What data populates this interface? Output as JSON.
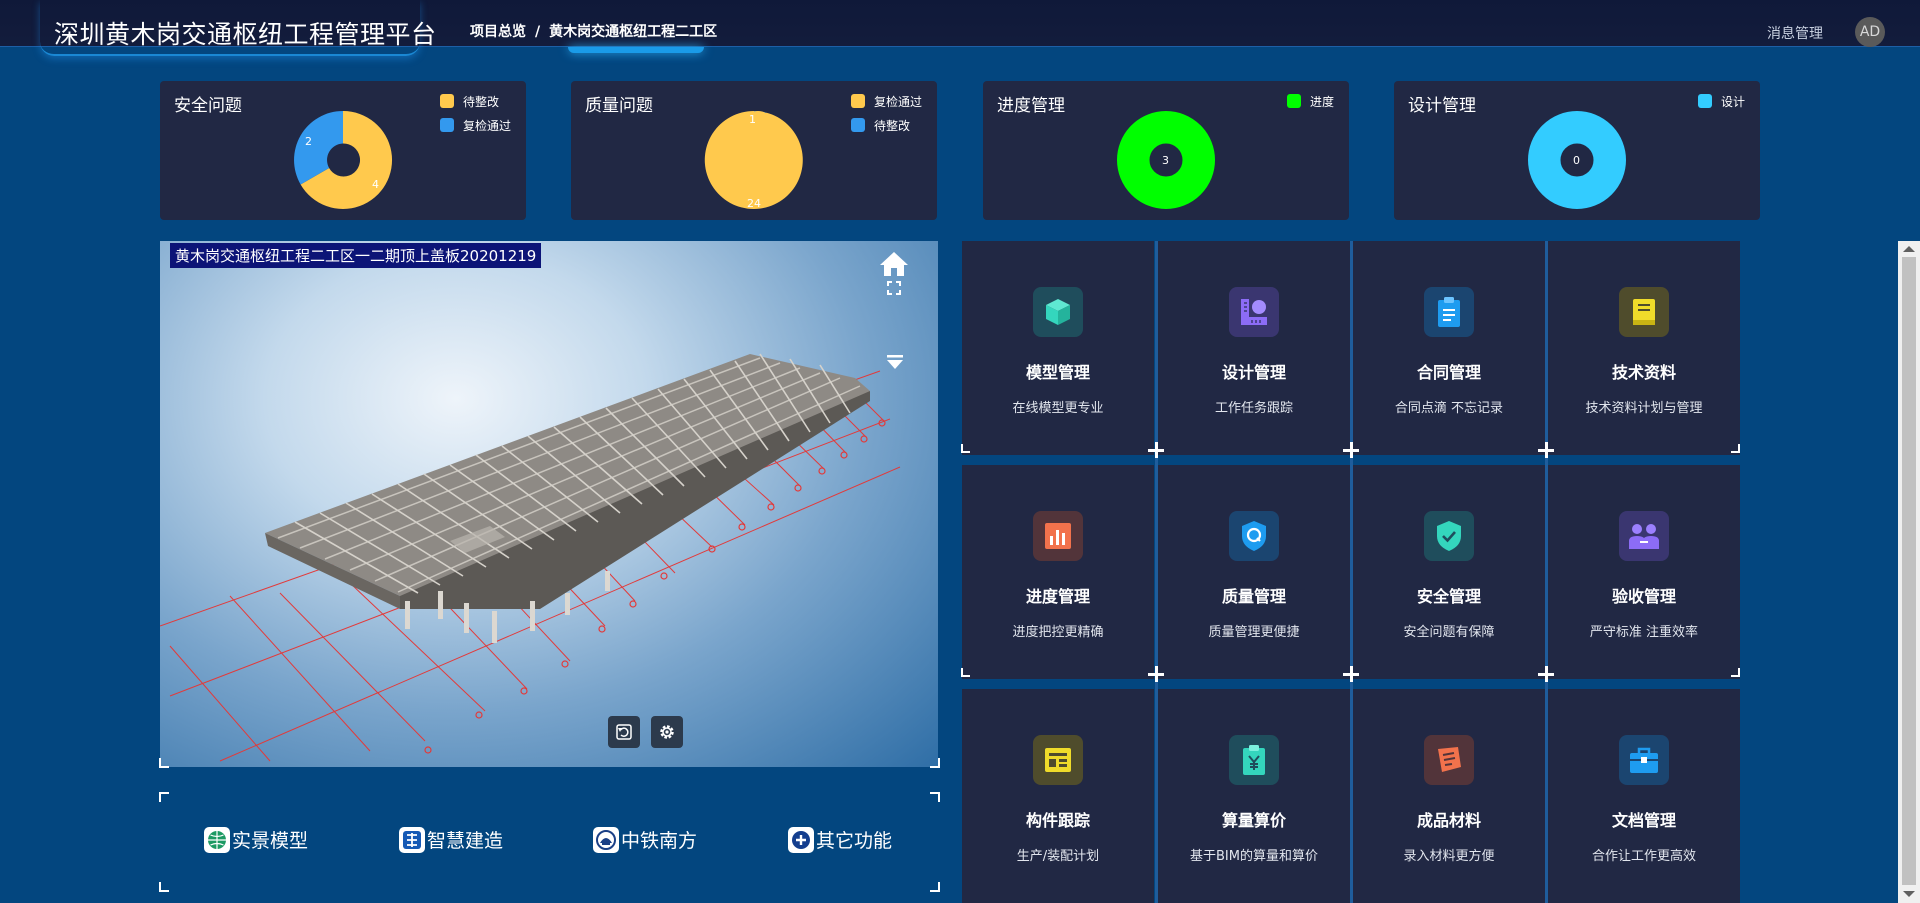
{
  "header": {
    "app_title": "深圳黄木岗交通枢纽工程管理平台",
    "breadcrumb": [
      "项目总览",
      "黄木岗交通枢纽工程二工区"
    ],
    "breadcrumb_separator": "/",
    "message_link": "消息管理",
    "avatar_initials": "AD"
  },
  "stats": [
    {
      "title": "安全问题",
      "legend": [
        {
          "label": "待整改",
          "color": "#ffc94d"
        },
        {
          "label": "复检通过",
          "color": "#3399ee"
        }
      ],
      "segments": [
        {
          "label": "复检通过",
          "value": 2,
          "color": "#3399ee"
        },
        {
          "label": "待整改",
          "value": 4,
          "color": "#ffc94d"
        }
      ]
    },
    {
      "title": "质量问题",
      "legend": [
        {
          "label": "复检通过",
          "color": "#ffc94d"
        },
        {
          "label": "待整改",
          "color": "#3399ee"
        }
      ],
      "segments": [
        {
          "label": "待整改",
          "value": 1,
          "color": "#3399ee"
        },
        {
          "label": "复检通过",
          "value": 24,
          "color": "#ffc94d"
        }
      ]
    },
    {
      "title": "进度管理",
      "legend": [
        {
          "label": "进度",
          "color": "#00ff00"
        }
      ],
      "segments": [
        {
          "label": "进度",
          "value": 3,
          "color": "#00ff00"
        }
      ],
      "center_value": "3"
    },
    {
      "title": "设计管理",
      "legend": [
        {
          "label": "设计",
          "color": "#33ccff"
        }
      ],
      "segments": [
        {
          "label": "设计",
          "value": 0,
          "color": "#33ccff"
        }
      ],
      "center_value": "0"
    }
  ],
  "viewer": {
    "caption": "黄木岗交通枢纽工程二工区一二期顶上盖板20201219"
  },
  "quick_links": [
    {
      "label": "实景模型",
      "icon": "globe-icon"
    },
    {
      "label": "智慧建造",
      "icon": "building-icon"
    },
    {
      "label": "中铁南方",
      "icon": "company-logo-icon"
    },
    {
      "label": "其它功能",
      "icon": "plus-circle-icon"
    }
  ],
  "modules": [
    {
      "name": "模型管理",
      "desc": "在线模型更专业",
      "icon": "cube-icon",
      "color": "#34d6bd",
      "bg": "#1f4d5c"
    },
    {
      "name": "设计管理",
      "desc": "工作任务跟踪",
      "icon": "design-icon",
      "color": "#8c6cf6",
      "bg": "#3a3670"
    },
    {
      "name": "合同管理",
      "desc": "合同点滴 不忘记录",
      "icon": "clipboard-icon",
      "color": "#1e9cf0",
      "bg": "#1b4570"
    },
    {
      "name": "技术资料",
      "desc": "技术资料计划与管理",
      "icon": "book-icon",
      "color": "#f0dc2a",
      "bg": "#4f4c2c"
    },
    {
      "name": "进度管理",
      "desc": "进度把控更精确",
      "icon": "bar-chart-icon",
      "color": "#f2724c",
      "bg": "#52343a"
    },
    {
      "name": "质量管理",
      "desc": "质量管理更便捷",
      "icon": "quality-shield-icon",
      "color": "#1e9cf0",
      "bg": "#1b4570"
    },
    {
      "name": "安全管理",
      "desc": "安全问题有保障",
      "icon": "safety-shield-icon",
      "color": "#34d6bd",
      "bg": "#1f4d5c"
    },
    {
      "name": "验收管理",
      "desc": "严守标准 注重效率",
      "icon": "people-icon",
      "color": "#8c6cf6",
      "bg": "#3a3670"
    },
    {
      "name": "构件跟踪",
      "desc": "生产/装配计划",
      "icon": "component-icon",
      "color": "#f0dc2a",
      "bg": "#4f4c2c"
    },
    {
      "name": "算量算价",
      "desc": "基于BIM的算量和算价",
      "icon": "price-tag-icon",
      "color": "#34d6bd",
      "bg": "#1f4d5c"
    },
    {
      "name": "成品材料",
      "desc": "录入材料更方便",
      "icon": "materials-icon",
      "color": "#f2724c",
      "bg": "#52343a"
    },
    {
      "name": "文档管理",
      "desc": "合作让工作更高效",
      "icon": "briefcase-icon",
      "color": "#1e9cf0",
      "bg": "#1b4570"
    }
  ]
}
